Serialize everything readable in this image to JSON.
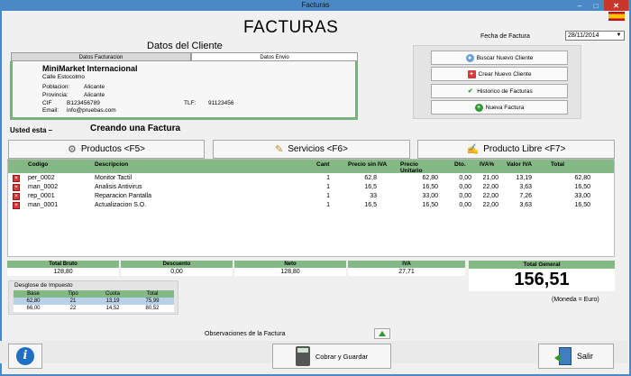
{
  "window": {
    "title": "Facturas",
    "min": "–",
    "max": "□",
    "close": "✕"
  },
  "app_title": "FACTURAS",
  "fecha": {
    "label": "Fecha de Factura",
    "value": "28/11/2014"
  },
  "datos_cliente": {
    "title": "Datos del Cliente",
    "tabs": [
      "Datos Facturacion",
      "Datos Envio"
    ],
    "name": "MiniMarket Internacional",
    "address": "Calle Estocolmo",
    "fields": [
      {
        "label": "Poblacion:",
        "value": "Alicante"
      },
      {
        "label": "Provincia:",
        "value": "Alicante"
      },
      {
        "label": "CIF",
        "value": "B123456789"
      },
      {
        "label": "Email:",
        "value": "info@pruebas.com"
      }
    ],
    "tlf_label": "TLF:",
    "tlf_value": "91123456"
  },
  "actions": {
    "buscar": "Buscar Nuevo Cliente",
    "crear": "Crear Nuevo Cliente",
    "historico": "Historico de Facturas",
    "nueva": "Nueva Factura"
  },
  "status": {
    "label": "Usted esta –",
    "value": "Creando una Factura"
  },
  "tabs_main": {
    "productos": "Productos <F5>",
    "servicios": "Servicios <F6>",
    "libre": "Producto Libre <F7>"
  },
  "grid": {
    "headers": {
      "codigo": "Codigo",
      "descripcion": "Descripcion",
      "cant": "Cant",
      "precio_sin_iva": "Precio sin IVA",
      "precio_unitario": "Precio Unitario",
      "dto": "Dto.",
      "iva_pct": "IVA%",
      "valor_iva": "Valor IVA",
      "total": "Total"
    },
    "rows": [
      {
        "codigo": "per_0002",
        "descripcion": "Monitor Tactil",
        "cant": "1",
        "precio_sin_iva": "62,8",
        "precio_unitario": "62,80",
        "dto": "0,00",
        "iva_pct": "21,00",
        "valor_iva": "13,19",
        "total": "62,80"
      },
      {
        "codigo": "man_0002",
        "descripcion": "Analisis Antivirus",
        "cant": "1",
        "precio_sin_iva": "16,5",
        "precio_unitario": "16,50",
        "dto": "0,00",
        "iva_pct": "22,00",
        "valor_iva": "3,63",
        "total": "16,50"
      },
      {
        "codigo": "rep_0001",
        "descripcion": "Reparacion Pantalla",
        "cant": "1",
        "precio_sin_iva": "33",
        "precio_unitario": "33,00",
        "dto": "0,00",
        "iva_pct": "22,00",
        "valor_iva": "7,26",
        "total": "33,00"
      },
      {
        "codigo": "man_0001",
        "descripcion": "Actualizacion S.O.",
        "cant": "1",
        "precio_sin_iva": "16,5",
        "precio_unitario": "16,50",
        "dto": "0,00",
        "iva_pct": "22,00",
        "valor_iva": "3,63",
        "total": "16,50"
      }
    ]
  },
  "totals": {
    "bruto_label": "Total Bruto",
    "bruto": "128,80",
    "descuento_label": "Descuento",
    "descuento": "0,00",
    "neto_label": "Neto",
    "neto": "128,80",
    "iva_label": "IVA",
    "iva": "27,71"
  },
  "total_general": {
    "label": "Total General",
    "value": "156,51",
    "moneda": "(Moneda = Euro)"
  },
  "desglose": {
    "title": "Desglose de Impuesto",
    "headers": [
      "Base",
      "Tipo",
      "Cuota",
      "Total"
    ],
    "rows": [
      [
        "62,80",
        "21",
        "13,19",
        "75,99"
      ],
      [
        "66,00",
        "22",
        "14,52",
        "80,52"
      ]
    ]
  },
  "observaciones": "Observaciones de la Factura",
  "bottom": {
    "info": "i",
    "cobrar": "Cobrar y Guardar",
    "salir": "Salir"
  },
  "icons": {
    "delete": "×",
    "check": "✔",
    "plus": "+"
  }
}
